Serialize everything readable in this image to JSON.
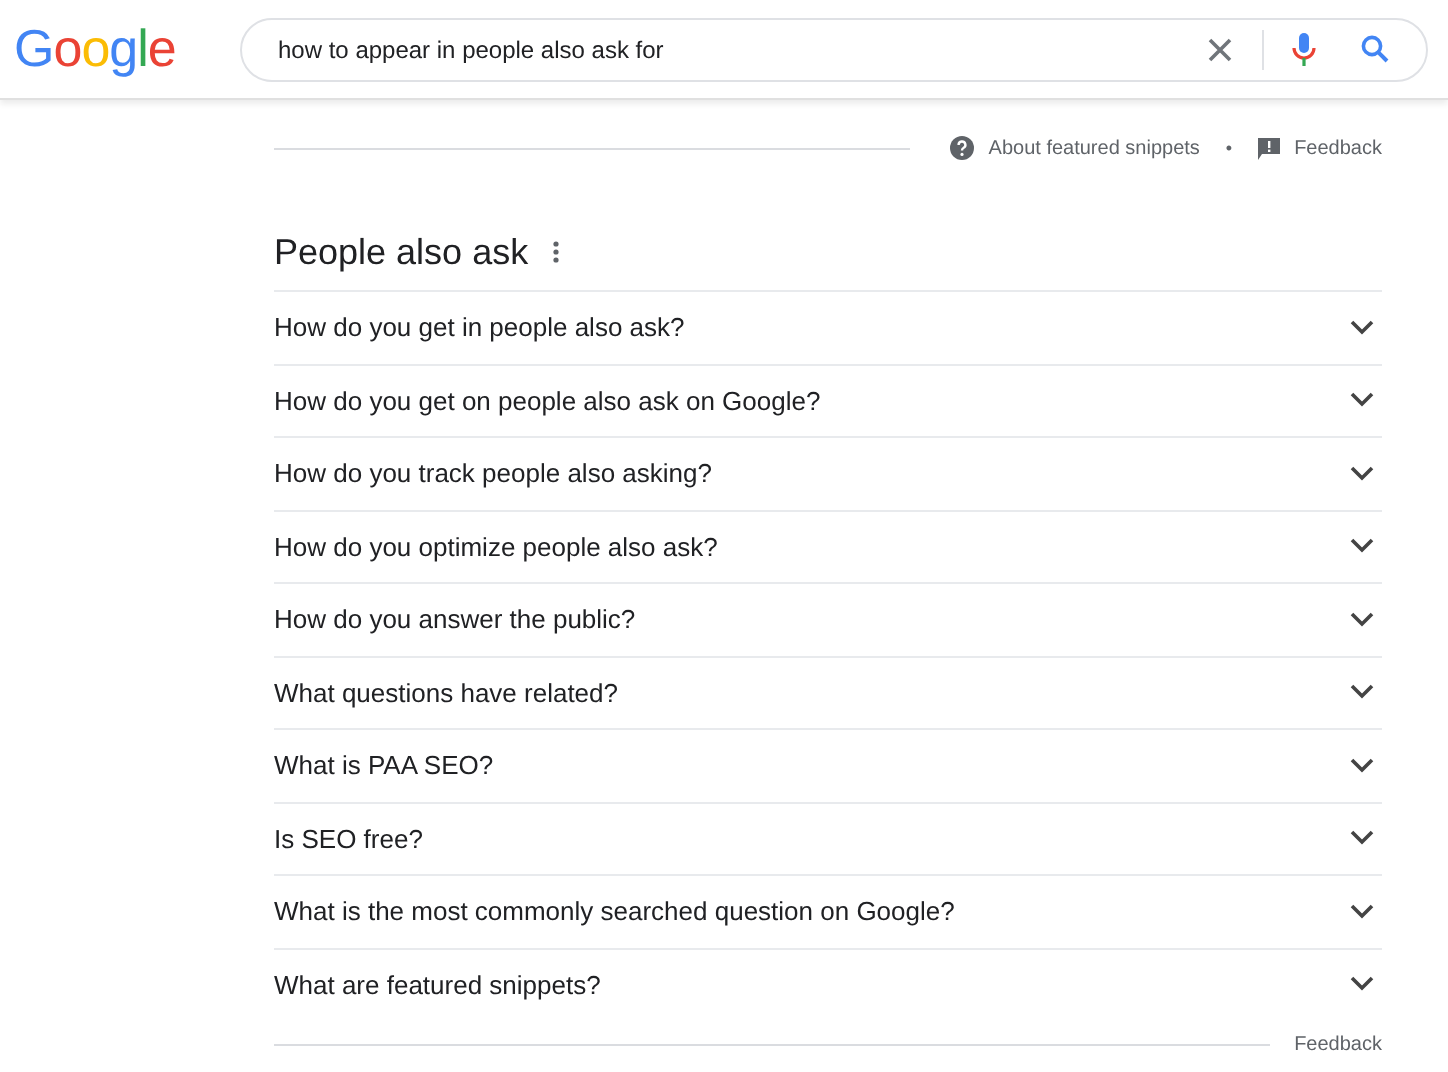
{
  "logo": "Google",
  "search": {
    "value": "how to appear in people also ask for"
  },
  "snippet_bar": {
    "about": "About featured snippets",
    "separator": "•",
    "feedback": "Feedback"
  },
  "people_also_ask": {
    "title": "People also ask",
    "questions": [
      {
        "text": "How do you get in people also ask?",
        "expanded": false
      },
      {
        "text": "How do you get on people also ask on Google?",
        "expanded": false
      },
      {
        "text": "How do you track people also asking?",
        "expanded": false
      },
      {
        "text": "How do you optimize people also ask?",
        "expanded": false
      },
      {
        "text": "How do you answer the public?",
        "expanded": false
      },
      {
        "text": "What questions have related?",
        "expanded": false
      },
      {
        "text": "What is PAA SEO?",
        "expanded": false
      },
      {
        "text": "Is SEO free?",
        "expanded": false
      },
      {
        "text": "What is the most commonly searched question on Google?",
        "expanded": false
      },
      {
        "text": "What are featured snippets?",
        "expanded": false
      }
    ],
    "feedback": "Feedback"
  }
}
